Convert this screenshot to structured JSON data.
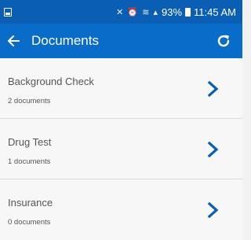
{
  "status_bar": {
    "time": "11:45 AM",
    "battery_percent": "93%",
    "icons": [
      "notification-icon",
      "mute-icon",
      "alarm-icon",
      "wifi-icon",
      "signal-icon",
      "battery-icon"
    ]
  },
  "app_bar": {
    "title": "Documents",
    "back_icon": "arrow-left-icon",
    "refresh_icon": "refresh-icon"
  },
  "colors": {
    "status_bar": "#0a5fb4",
    "app_bar": "#0a6cc9",
    "chevron": "#0a5fb4",
    "text": "#555555"
  },
  "documents": [
    {
      "title": "Background Check",
      "count_text": "2 documents"
    },
    {
      "title": "Drug Test",
      "count_text": "1 documents"
    },
    {
      "title": "Insurance",
      "count_text": "0 documents"
    }
  ]
}
